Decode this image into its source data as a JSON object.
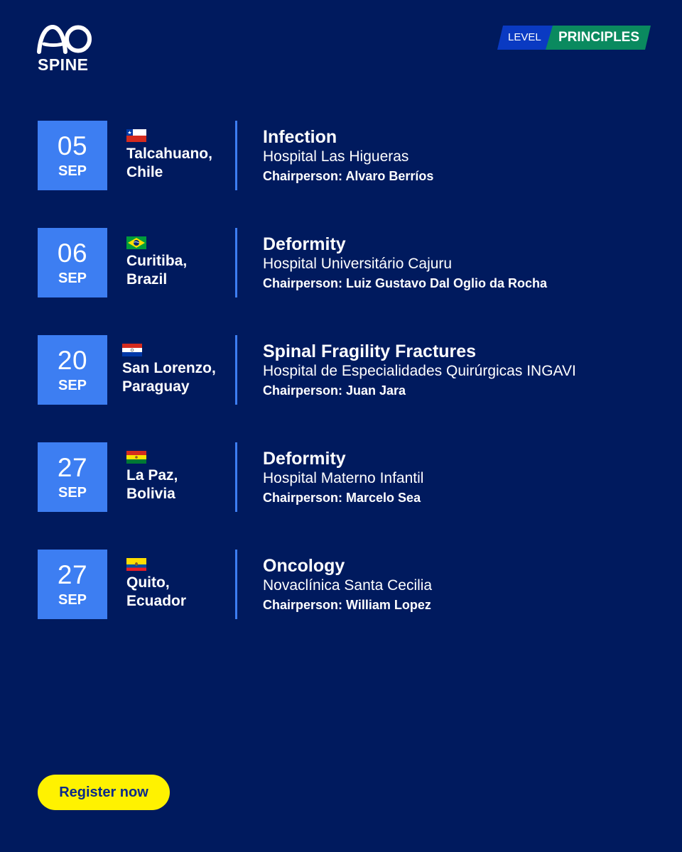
{
  "brand": {
    "logo_text": "AO",
    "logo_subtitle": "SPINE"
  },
  "level": {
    "label": "LEVEL",
    "value": "PRINCIPLES"
  },
  "colors": {
    "background": "#001a5e",
    "accent_blue": "#3d7ef2",
    "level_green": "#0a8a5f",
    "cta_yellow": "#fff200"
  },
  "events": [
    {
      "day": "05",
      "month": "SEP",
      "flag": "chile-flag-icon",
      "city_line1": "Talcahuano,",
      "city_line2": "Chile",
      "topic": "Infection",
      "hospital": "Hospital Las Higueras",
      "chairperson": "Chairperson: Alvaro Berríos"
    },
    {
      "day": "06",
      "month": "SEP",
      "flag": "brazil-flag-icon",
      "city_line1": "Curitiba,",
      "city_line2": "Brazil",
      "topic": "Deformity",
      "hospital": "Hospital Universitário Cajuru",
      "chairperson": "Chairperson: Luiz Gustavo Dal Oglio da Rocha"
    },
    {
      "day": "20",
      "month": "SEP",
      "flag": "paraguay-flag-icon",
      "city_line1": "San Lorenzo,",
      "city_line2": "Paraguay",
      "topic": "Spinal Fragility Fractures",
      "hospital": "Hospital de Especialidades Quirúrgicas INGAVI",
      "chairperson": "Chairperson: Juan Jara"
    },
    {
      "day": "27",
      "month": "SEP",
      "flag": "bolivia-flag-icon",
      "city_line1": "La Paz,",
      "city_line2": "Bolivia",
      "topic": "Deformity",
      "hospital": "Hospital Materno Infantil",
      "chairperson": "Chairperson: Marcelo Sea"
    },
    {
      "day": "27",
      "month": "SEP",
      "flag": "ecuador-flag-icon",
      "city_line1": "Quito,",
      "city_line2": "Ecuador",
      "topic": "Oncology",
      "hospital": "Novaclínica Santa Cecilia",
      "chairperson": "Chairperson: William Lopez"
    }
  ],
  "cta": {
    "label": "Register now"
  }
}
